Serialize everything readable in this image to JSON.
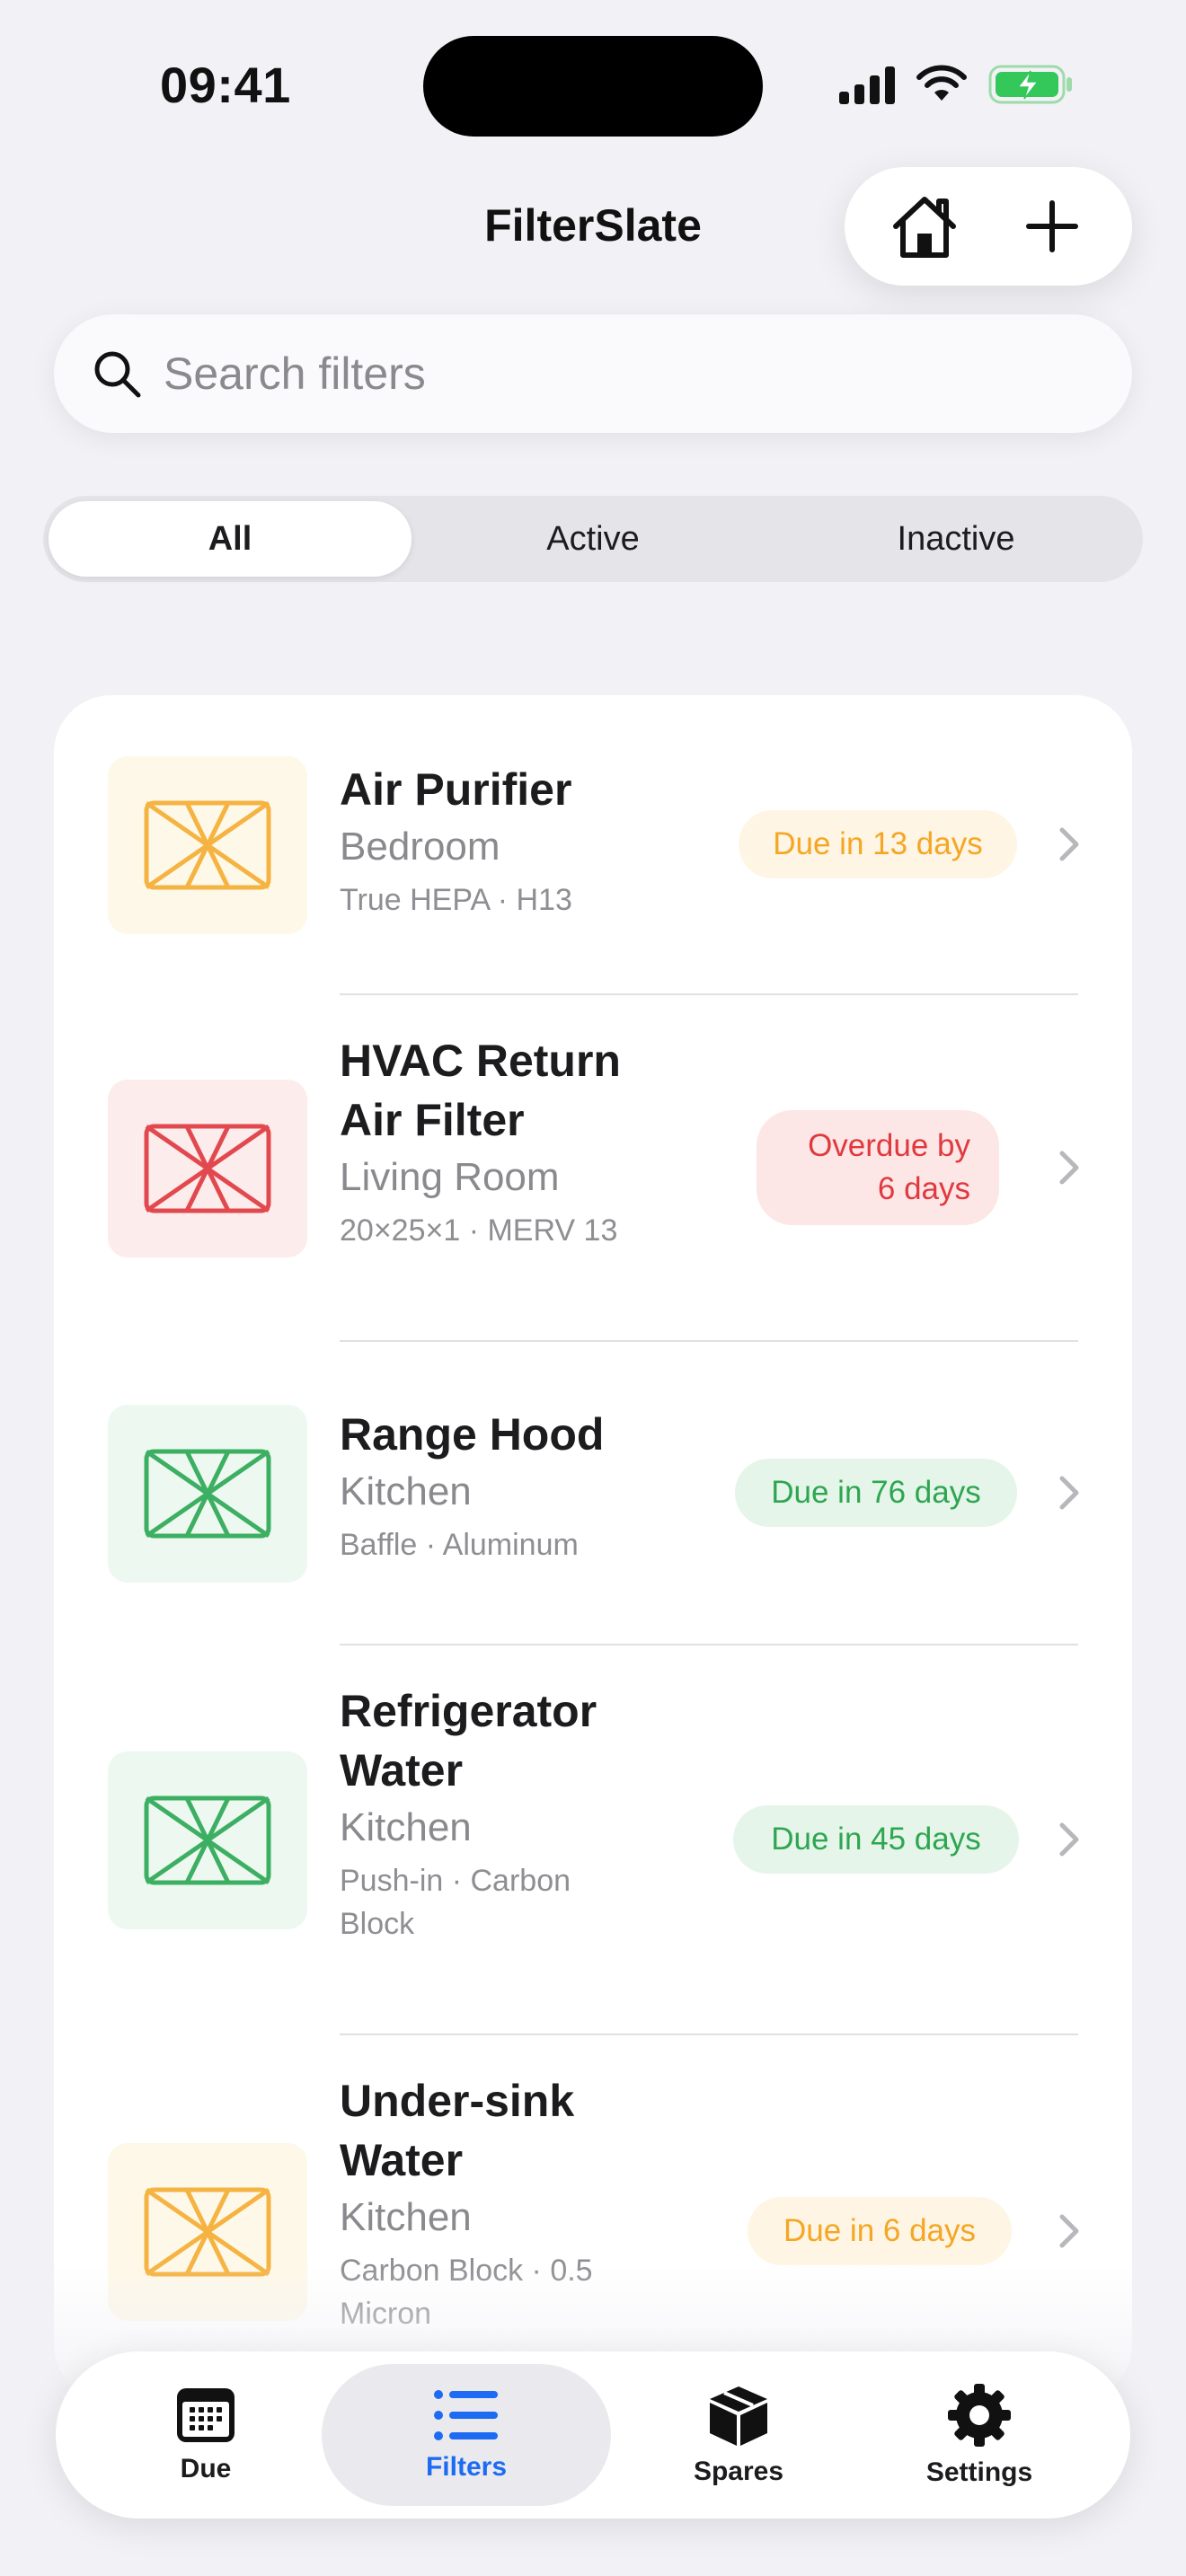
{
  "status_bar": {
    "time": "09:41"
  },
  "header": {
    "title": "FilterSlate"
  },
  "search": {
    "placeholder": "Search filters",
    "value": ""
  },
  "segments": [
    "All",
    "Active",
    "Inactive"
  ],
  "filters": [
    {
      "name": "Air Purifier",
      "room": "Bedroom",
      "spec": "True HEPA · H13",
      "status": "Due in 13 days",
      "state": "soon"
    },
    {
      "name": "HVAC Return Air Filter",
      "room": "Living Room",
      "spec": "20×25×1 · MERV 13",
      "status": "Overdue by 6 days",
      "state": "overdue"
    },
    {
      "name": "Range Hood",
      "room": "Kitchen",
      "spec": "Baffle · Aluminum",
      "status": "Due in 76 days",
      "state": "ok"
    },
    {
      "name": "Refrigerator Water",
      "room": "Kitchen",
      "spec": "Push-in · Carbon Block",
      "status": "Due in 45 days",
      "state": "ok"
    },
    {
      "name": "Under-sink Water",
      "room": "Kitchen",
      "spec": "Carbon Block · 0.5 Micron",
      "status": "Due in 6 days",
      "state": "soon"
    }
  ],
  "tabs": [
    "Due",
    "Filters",
    "Spares",
    "Settings"
  ],
  "colors": {
    "soon": "#F5A623",
    "soon_bg": "#FEF5E4",
    "overdue": "#E0393E",
    "overdue_bg": "#FDE6E6",
    "ok": "#2EA651",
    "ok_bg": "#E5F5E9",
    "accent": "#1D6BF3"
  }
}
